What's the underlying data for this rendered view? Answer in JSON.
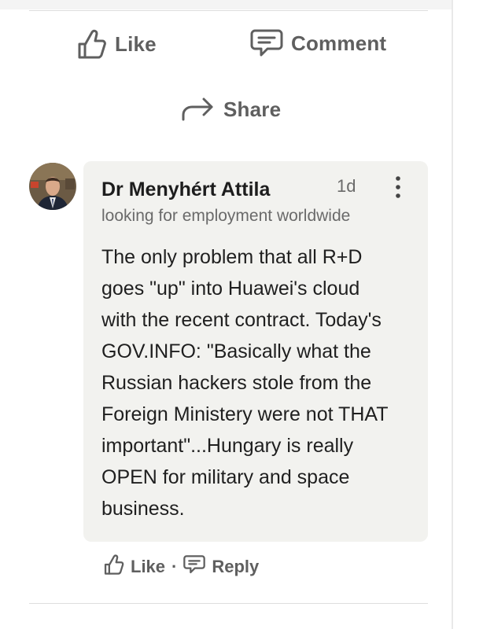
{
  "post_actions": {
    "like": "Like",
    "comment": "Comment",
    "share": "Share"
  },
  "comment": {
    "author": "Dr Menyhért Attila",
    "time": "1d",
    "headline": "looking for employment worldwide",
    "text": "The only problem that all R+D\ngoes \"up\" into Huawei's cloud\nwith the recent contract. Today's\nGOV.INFO: \"Basically what the\nRussian hackers stole from the\nForeign Ministery were not THAT\nimportant\"...Hungary is really\nOPEN for military and space\nbusiness.",
    "actions": {
      "like": "Like",
      "separator": "·",
      "reply": "Reply"
    }
  },
  "icons": {
    "like": "thumbs-up-icon",
    "comment": "speech-bubble-icon",
    "share": "share-arrow-icon",
    "more": "vertical-dots-icon"
  },
  "colors": {
    "bubble": "#f2f2ef",
    "action_text": "#5f5f5f",
    "body_text": "#1f1f1f",
    "muted_text": "#6a6a6a"
  }
}
